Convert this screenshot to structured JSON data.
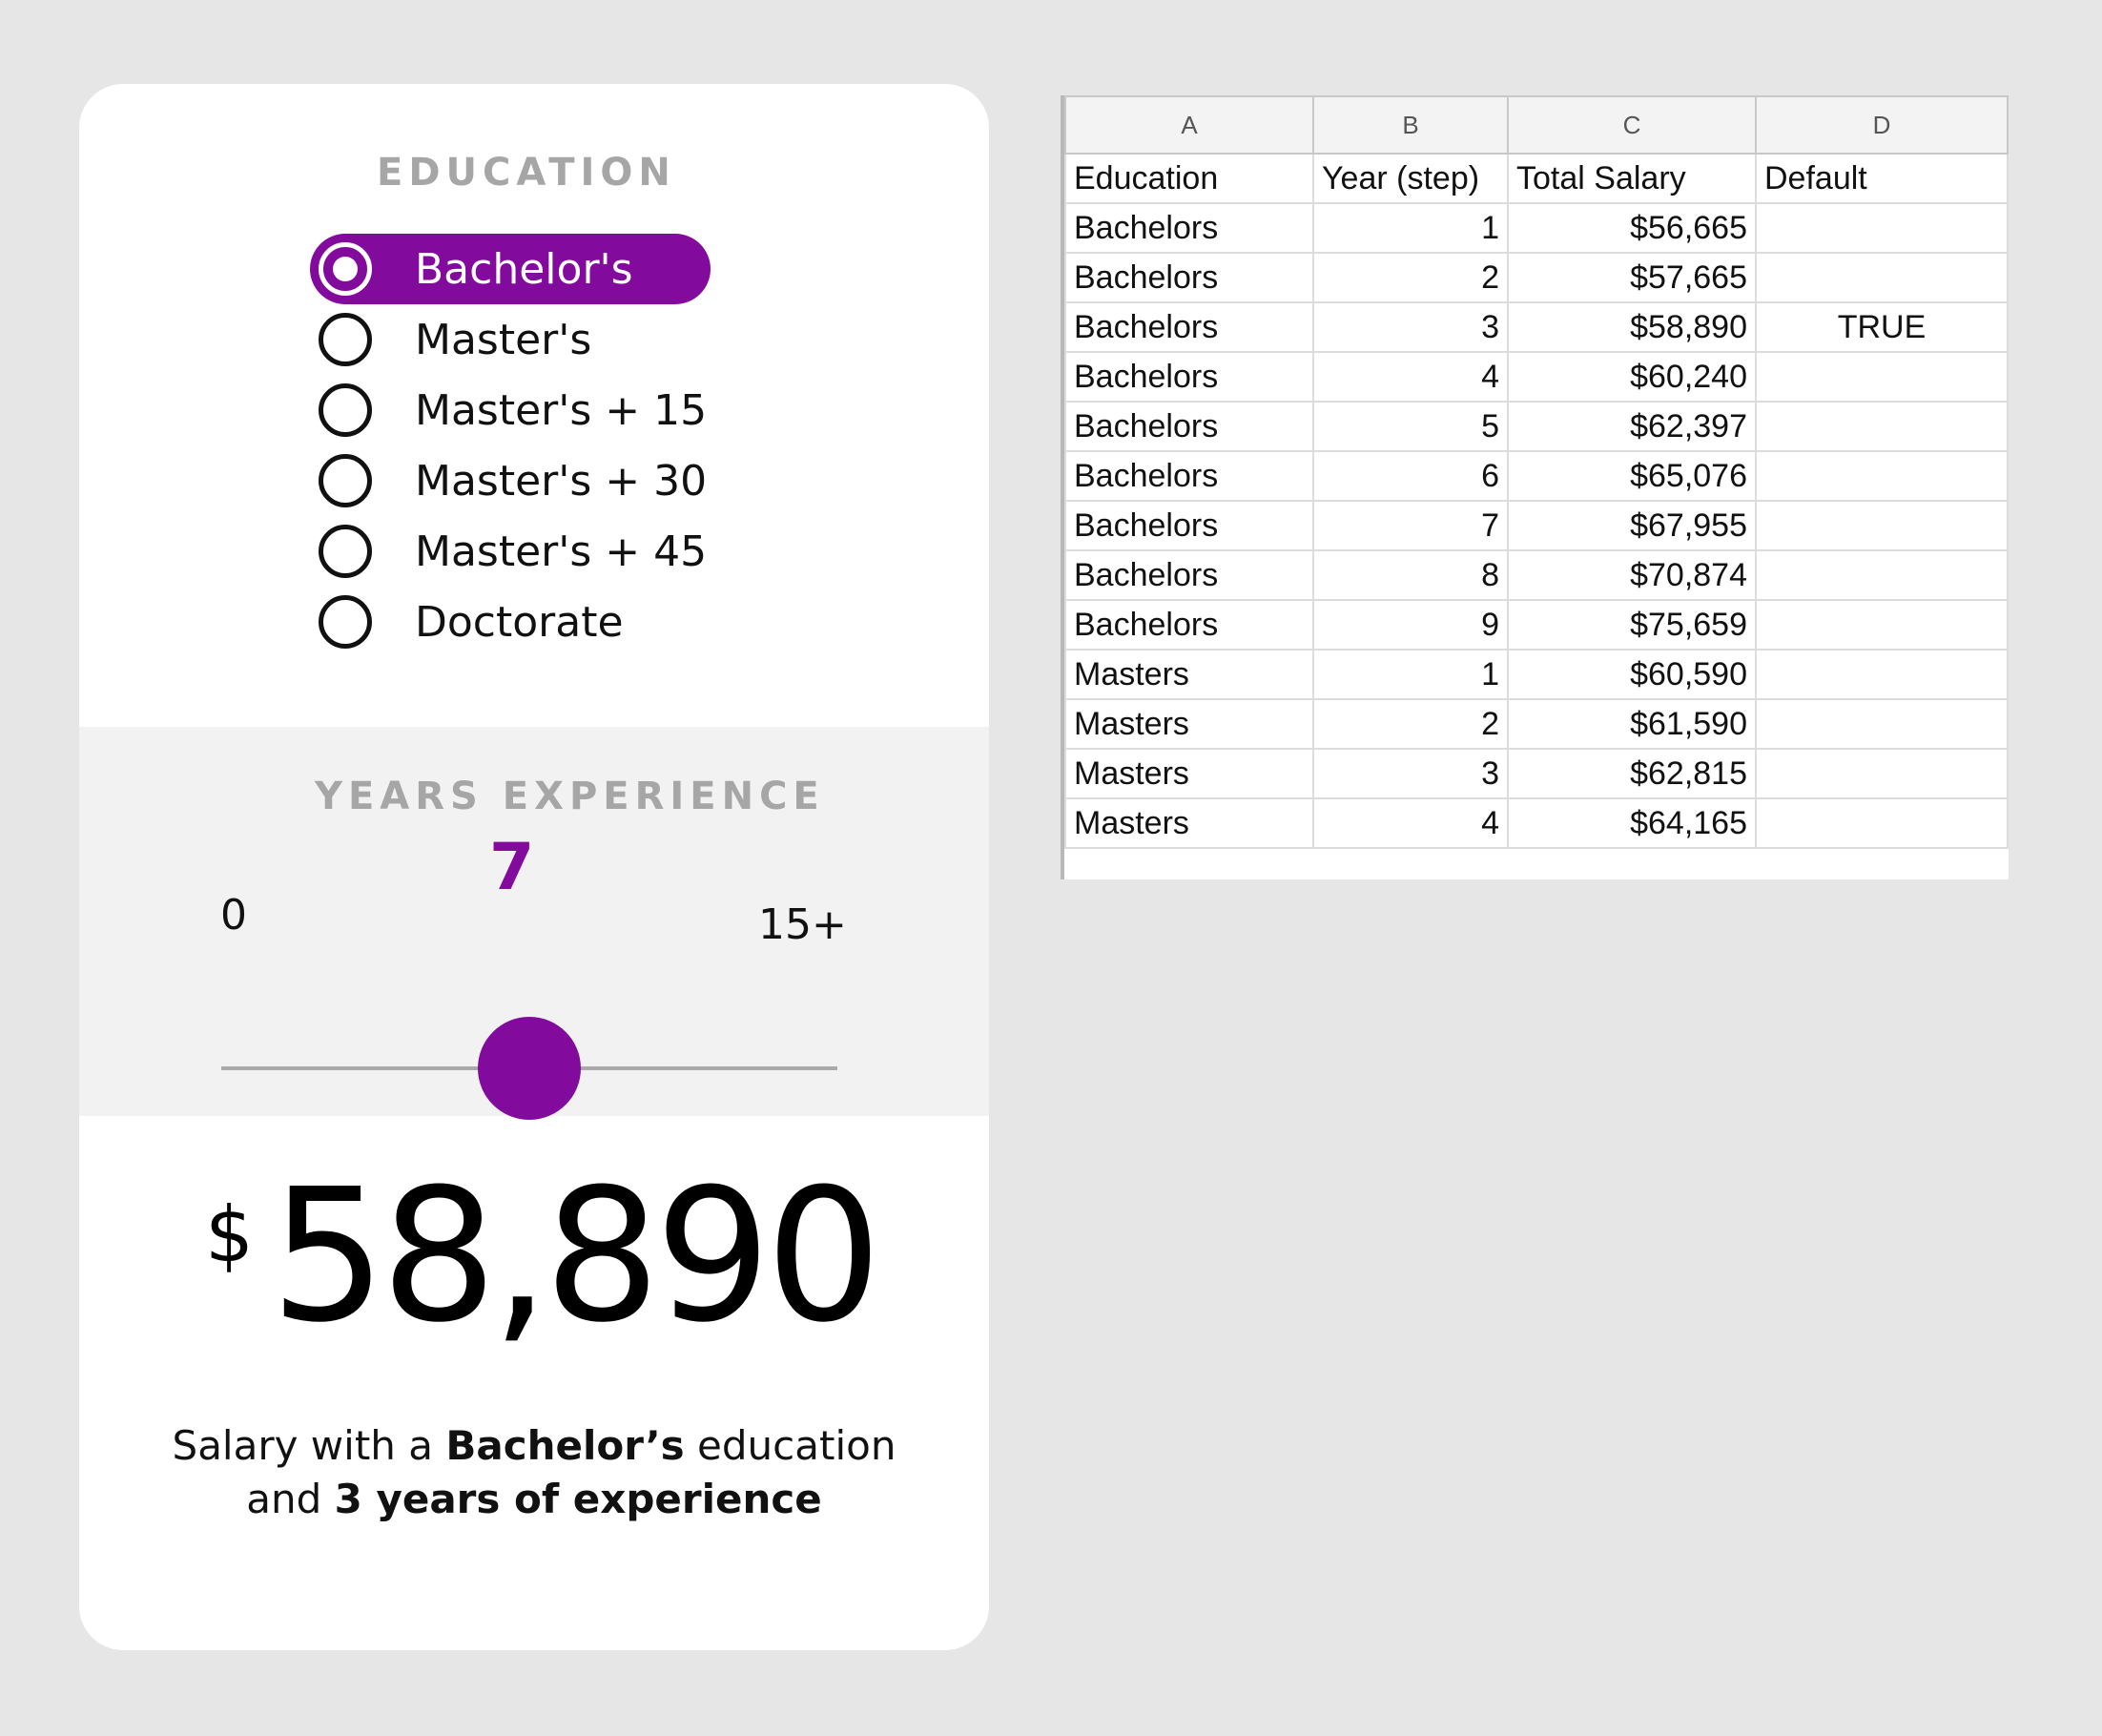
{
  "calculator": {
    "education": {
      "title": "EDUCATION",
      "selected_index": 0,
      "options": [
        {
          "label": "Bachelor's"
        },
        {
          "label": "Master's"
        },
        {
          "label": "Master's + 15"
        },
        {
          "label": "Master's + 30"
        },
        {
          "label": "Master's + 45"
        },
        {
          "label": "Doctorate"
        }
      ]
    },
    "experience": {
      "title": "YEARS EXPERIENCE",
      "value": "7",
      "min_label": "0",
      "max_label": "15+",
      "slider_fraction": 0.5
    },
    "result": {
      "currency_symbol": "$",
      "salary": "58,890",
      "summary_prefix": "Salary with a ",
      "summary_education": "Bachelor’s",
      "summary_middle": " education",
      "summary_and": "and ",
      "summary_years": "3 years of experience"
    },
    "accent_color": "#820a9d"
  },
  "spreadsheet": {
    "column_letters": [
      "A",
      "B",
      "C",
      "D"
    ],
    "headers": [
      "Education",
      "Year (step)",
      "Total Salary",
      "Default"
    ],
    "rows": [
      [
        "Bachelors",
        "1",
        "$56,665",
        ""
      ],
      [
        "Bachelors",
        "2",
        "$57,665",
        ""
      ],
      [
        "Bachelors",
        "3",
        "$58,890",
        "TRUE"
      ],
      [
        "Bachelors",
        "4",
        "$60,240",
        ""
      ],
      [
        "Bachelors",
        "5",
        "$62,397",
        ""
      ],
      [
        "Bachelors",
        "6",
        "$65,076",
        ""
      ],
      [
        "Bachelors",
        "7",
        "$67,955",
        ""
      ],
      [
        "Bachelors",
        "8",
        "$70,874",
        ""
      ],
      [
        "Bachelors",
        "9",
        "$75,659",
        ""
      ],
      [
        "Masters",
        "1",
        "$60,590",
        ""
      ],
      [
        "Masters",
        "2",
        "$61,590",
        ""
      ],
      [
        "Masters",
        "3",
        "$62,815",
        ""
      ],
      [
        "Masters",
        "4",
        "$64,165",
        ""
      ]
    ]
  }
}
